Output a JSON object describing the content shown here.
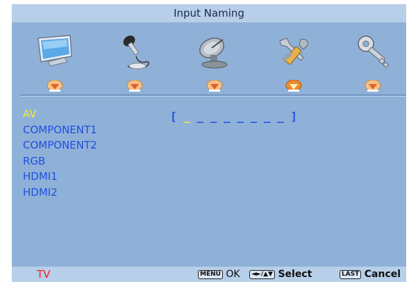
{
  "title": "Input Naming",
  "menu_icons": [
    "monitor-icon",
    "microphone-icon",
    "satellite-dish-icon",
    "tools-icon",
    "key-icon"
  ],
  "active_menu_index": 3,
  "inputs": [
    "AV",
    "COMPONENT1",
    "COMPONENT2",
    "RGB",
    "HDMI1",
    "HDMI2"
  ],
  "selected_input": "AV",
  "name_field": {
    "open_bracket": "[",
    "cursor": "_",
    "placeholder": " _ _ _ _ _ _ _ ",
    "close_bracket": "]"
  },
  "footer": {
    "source": "TV",
    "menu_key": "MENU",
    "ok_label": "OK",
    "nav_key": "◄►/▲▼",
    "select_label": "Select",
    "last_key": "LAST",
    "cancel_label": "Cancel"
  },
  "colors": {
    "panel": "#8fb1d8",
    "titlebar": "#b8cfe9",
    "item_text": "#1f4fe0",
    "selected_text": "#f2ec3a",
    "source_text": "#e8281e",
    "marker": "#f4c188",
    "marker_active": "#f08a2c"
  }
}
